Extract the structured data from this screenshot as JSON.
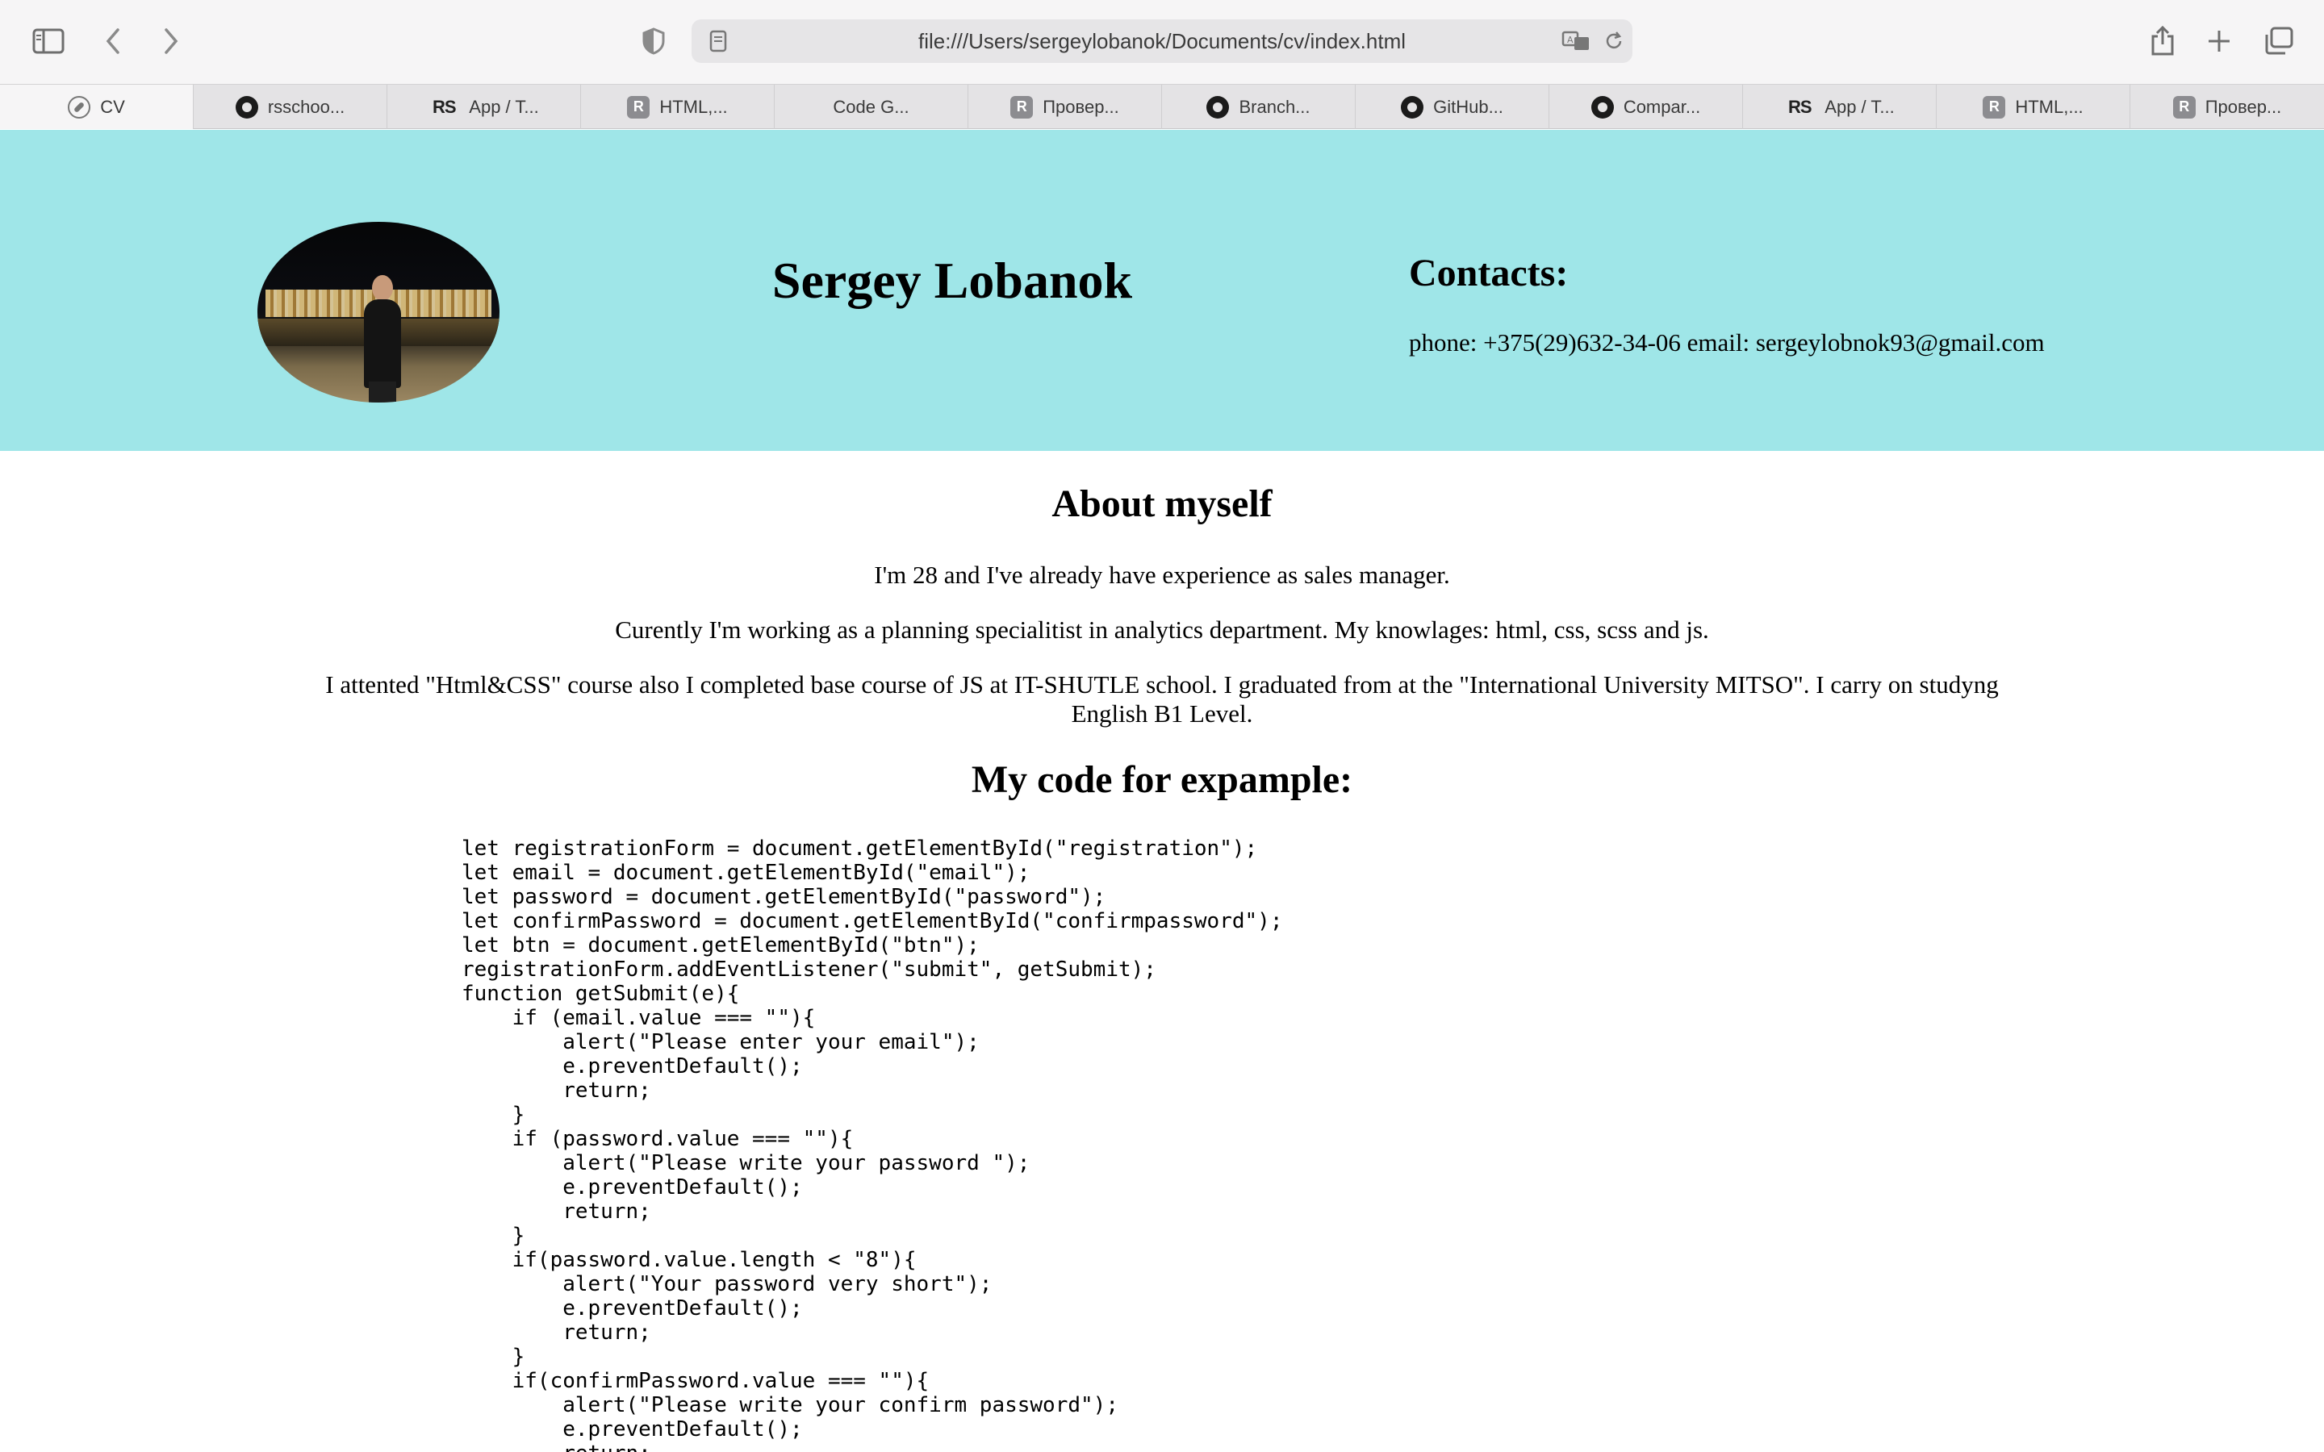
{
  "browser": {
    "url": "file:///Users/sergeylobanok/Documents/cv/index.html",
    "tabs": [
      {
        "label": "CV",
        "icon": "compass-icon",
        "active": true
      },
      {
        "label": "rsschoo...",
        "icon": "github-icon"
      },
      {
        "label": "App / T...",
        "icon": "rs-icon"
      },
      {
        "label": "HTML,...",
        "icon": "r-icon"
      },
      {
        "label": "Code G...",
        "icon": "code-icon"
      },
      {
        "label": "Провер...",
        "icon": "r-icon"
      },
      {
        "label": "Branch...",
        "icon": "github-icon"
      },
      {
        "label": "GitHub...",
        "icon": "github-icon"
      },
      {
        "label": "Compar...",
        "icon": "github-icon"
      },
      {
        "label": "App / T...",
        "icon": "rs-icon"
      },
      {
        "label": "HTML,...",
        "icon": "r-icon"
      },
      {
        "label": "Провер...",
        "icon": "r-icon"
      }
    ]
  },
  "header": {
    "name": "Sergey Lobanok",
    "contacts_title": "Contacts:",
    "contacts_line": "phone: +375(29)632-34-06 email: sergeylobnok93@gmail.com",
    "background": "#9fe6e8"
  },
  "about": {
    "title": "About myself",
    "p1": "I'm 28 and I've already have experience as sales manager.",
    "p2": "Curently I'm working as a planning specialitist in analytics department. My knowlages: html, css, scss and js.",
    "p3": "I attented \"Html&CSS\" course also I completed base course of JS at IT-SHUTLE school. I graduated from at the \"International University MITSO\". I carry on studyng English B1 Level."
  },
  "code_section": {
    "title": "My code for expample:",
    "code": "let registrationForm = document.getElementById(\"registration\");\nlet email = document.getElementById(\"email\");\nlet password = document.getElementById(\"password\");\nlet confirmPassword = document.getElementById(\"confirmpassword\");\nlet btn = document.getElementById(\"btn\");\nregistrationForm.addEventListener(\"submit\", getSubmit);\nfunction getSubmit(e){\n    if (email.value === \"\"){\n        alert(\"Please enter your email\");\n        e.preventDefault();\n        return;\n    }\n    if (password.value === \"\"){\n        alert(\"Please write your password \");\n        e.preventDefault();\n        return;\n    }\n    if(password.value.length < \"8\"){\n        alert(\"Your password very short\");\n        e.preventDefault();\n        return;\n    }\n    if(confirmPassword.value === \"\"){\n        alert(\"Please write your confirm password\");\n        e.preventDefault();\n        return;"
  }
}
